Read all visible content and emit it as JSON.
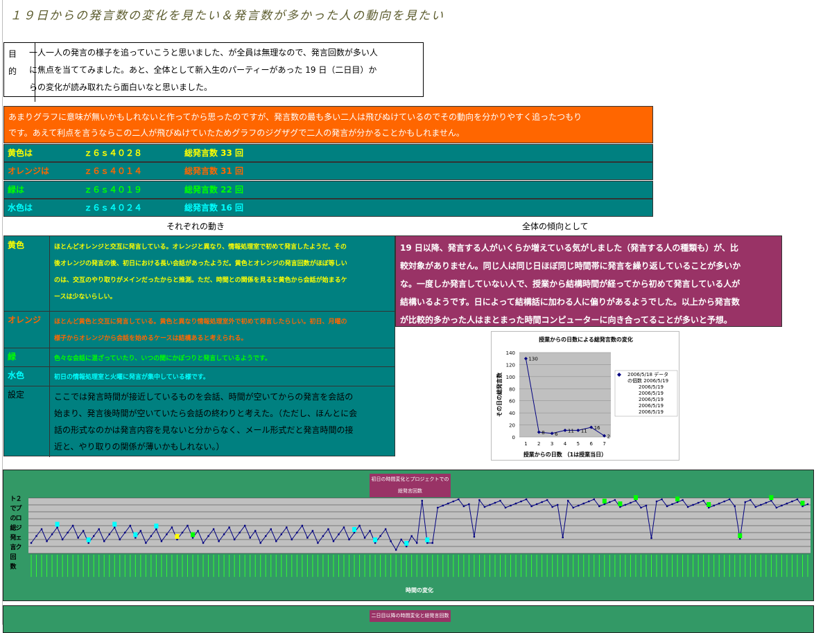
{
  "title": "１９日からの発言数の変化を見たい＆発言数が多かった人の動向を見たい",
  "purpose": {
    "label": "目的",
    "lines": [
      "一人一人の発言の様子を追っていこうと思いました、が全員は無理なので、発言回数が多い人",
      "に焦点を当ててみました。あと、全体として新入生のパーティーがあった 19 日（二日目）か",
      "らの変化が読み取れたら面白いなと思いました。"
    ]
  },
  "note": {
    "lines": [
      "あまりグラフに意味が無いかもしれないと作ってから思ったのですが、発言数の最も多い二人は飛びぬけているのでその動向を分かりやすく追ったつもり",
      "です。あえて利点を言うならこの二人が飛びぬけていたためグラフのジグザグで二人の発言が分かることかもしれません。"
    ],
    "color": "#ff6600"
  },
  "people": [
    {
      "label": "黄色は",
      "id": "ｚ６ｓ４０２８",
      "total": "総発言数 33 回",
      "color": "#ffff00"
    },
    {
      "label": "オレンジは",
      "id": "ｚ６ｓ４０１４",
      "total": "総発言数 31 回",
      "color": "#ff6600"
    },
    {
      "label": "緑は",
      "id": "ｚ６ｓ４０１９",
      "total": "総発言数 22 回",
      "color": "#00ff00"
    },
    {
      "label": "水色は",
      "id": "ｚ６ｓ４０２４",
      "total": "総発言数 16 回",
      "color": "#00ffff"
    }
  ],
  "headings": {
    "individual": "それぞれの動き",
    "overall": "全体の傾向として"
  },
  "movements": [
    {
      "key": "黄色",
      "color": "#ffff00",
      "lines": [
        "ほとんどオレンジと交互に発言している。オレンジと異なり、情報処理室で初めて発言したようだ。その",
        "後オレンジの発言の後、初日における長い会話があったようだ。黄色とオレンジの発言回数がほぼ等しい",
        "のは、交互のやり取りがメインだったからと推測。ただ、時間との関係を見ると黄色から会話が始まるケ",
        "ースは少ないらしい。"
      ]
    },
    {
      "key": "オレンジ",
      "color": "#ff6600",
      "lines": [
        "ほとんど黄色と交互に発言している。黄色と異なり情報処理室外で初めて発言したらしい。初日、月曜の",
        "様子からオレンジから会話を始めるケースは結構あると考えられる。"
      ]
    },
    {
      "key": "緑",
      "color": "#00ff00",
      "lines": [
        "色々な会話に混ざっていたり、いつの間にかぽつりと発言しているようです。"
      ]
    },
    {
      "key": "水色",
      "color": "#00ffff",
      "lines": [
        "初日の情報処理室と火曜に発言が集中している様です。"
      ]
    },
    {
      "key": "設定",
      "color": "#000000",
      "lines": [
        "ここでは発言時間が接近しているものを会話、時間が空いてからの発言を会話の",
        "始まり、発言後時間が空いていたら会話の終わりと考えた。（ただし、ほんとに会",
        "話の形式なのかは発言内容を見ないと分からなく、メール形式だと発言時間の接",
        "近と、やり取りの関係が薄いかもしれない。）"
      ]
    }
  ],
  "overall": {
    "lines": [
      "19 日以降、発言する人がいくらか増えている気がしました（発言する人の種類も）が、比",
      "較対象がありません。同じ人は同じ日ほぼ同じ時間帯に発言を繰り返していることが多いか",
      "な。一度しか発言していない人で、授業から結構時間が経ってから初めて発言している人が",
      "結構いるようです。日によって結構話に加わる人に偏りがあるようでした。以上から発言数",
      "が比較的多かった人はまとまった時間コンピューターに向き合ってることが多いと予想。"
    ]
  },
  "chart_data": [
    {
      "type": "line",
      "title": "授業からの日数による総発言数の変化",
      "xlabel": "授業からの日数 （1は授業当日）",
      "ylabel": "その日の総発言数",
      "x": [
        1,
        2,
        3,
        4,
        5,
        6,
        7
      ],
      "series": [
        {
          "name": "2006/5/18 データの個数 2006/5/19",
          "values": [
            130,
            8,
            6,
            11,
            11,
            16,
            2
          ]
        }
      ],
      "legend_lines": [
        "2006/5/18 データ",
        "の個数 2006/5/19",
        "2006/5/19",
        "2006/5/19",
        "2006/5/19",
        "2006/5/19",
        "2006/5/19"
      ],
      "ylim": [
        0,
        140
      ],
      "yticks": [
        0,
        20,
        40,
        60,
        80,
        100,
        120,
        140
      ],
      "grid": true,
      "legend": "right"
    },
    {
      "type": "line",
      "title": "初日の時間変化とプロジェクトでの総発言回数",
      "xlabel": "時間の変化",
      "ylabel": "２プロジェクトでの総発言回数",
      "grid": true
    }
  ],
  "band2_title": "二日目以降の時間変化と総発言回数",
  "colors": {
    "teal": "#008080",
    "magenta": "#993366",
    "green": "#339966",
    "orange": "#ff6600"
  }
}
